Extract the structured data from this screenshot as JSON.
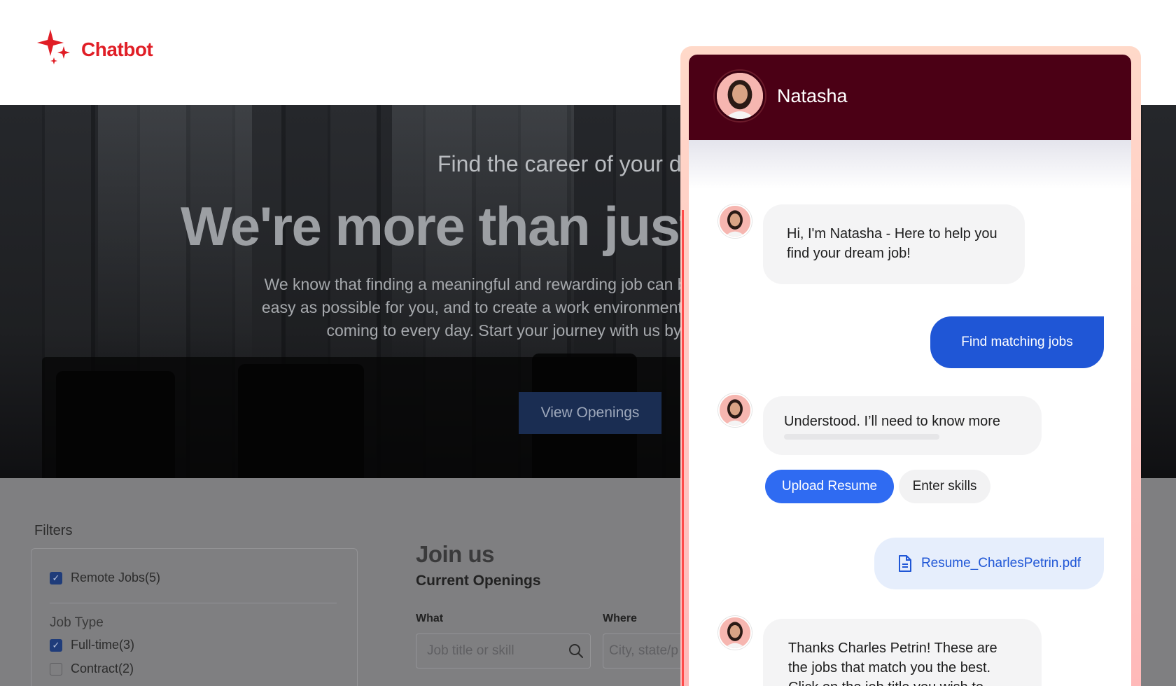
{
  "brand": {
    "name": "Chatbot",
    "accent": "#e01e26"
  },
  "hero": {
    "subtitle": "Find the career of your d",
    "title": "We're more than just",
    "description_lines": [
      "We know that finding a meaningful and rewarding job can be a long",
      "easy as possible for you, and to create a work environment that's sa",
      "coming to every day. Start your journey with us by"
    ],
    "cta": "View Openings"
  },
  "filters": {
    "title": "Filters",
    "remote": {
      "label": "Remote Jobs(5)",
      "checked": true
    },
    "job_type": {
      "heading": "Job Type",
      "options": [
        {
          "label": "Full-time(3)",
          "checked": true
        },
        {
          "label": "Contract(2)",
          "checked": false
        }
      ]
    }
  },
  "openings": {
    "heading": "Join us",
    "subheading": "Current Openings",
    "what_label": "What",
    "what_placeholder": "Job title or skill",
    "where_label": "Where",
    "where_placeholder": "City, state/p"
  },
  "chat": {
    "agent_name": "Natasha",
    "header_color": "#4b0015",
    "messages": [
      {
        "from": "bot",
        "text": "Hi, I'm Natasha - Here to help you find your dream job!"
      },
      {
        "from": "user",
        "text": "Find matching jobs"
      },
      {
        "from": "bot",
        "text": "Understood. I’ll need to know more"
      },
      {
        "from": "user",
        "type": "file",
        "text": "Resume_CharlesPetrin.pdf",
        "icon": "document-icon"
      },
      {
        "from": "bot",
        "text": "Thanks Charles Petrin! These are the jobs that match you the best. Click on the job title you wish to"
      }
    ],
    "quick_replies": [
      {
        "label": "Upload Resume",
        "primary": true
      },
      {
        "label": "Enter skills",
        "primary": false
      }
    ],
    "user_bubble_color": "#1f56d6"
  }
}
